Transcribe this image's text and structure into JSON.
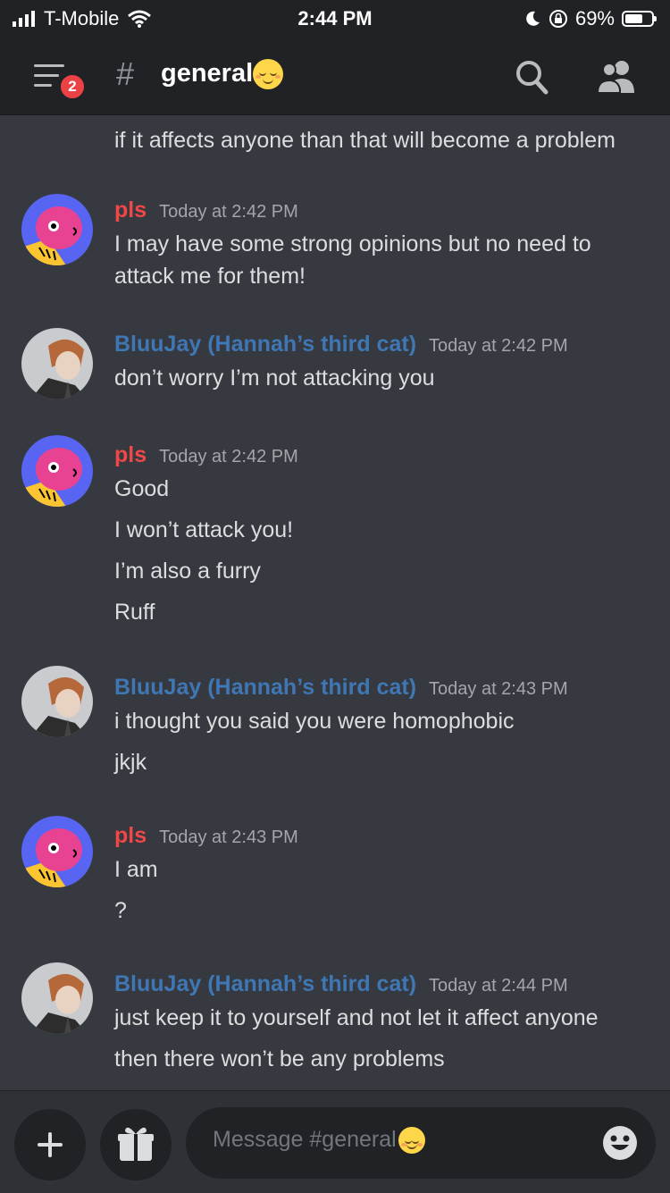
{
  "status_bar": {
    "carrier": "T-Mobile",
    "time": "2:44 PM",
    "battery_percent": "69%",
    "battery_level": 0.69
  },
  "header": {
    "unread_badge": "2",
    "hash": "#",
    "channel_name": "general"
  },
  "colors": {
    "background": "#36393f",
    "header": "#202225",
    "pls_name": "#f04747",
    "bluujay_name": "#3f77b4",
    "badge": "#ed4245"
  },
  "messages": {
    "continued": {
      "lines": [
        "if it affects anyone than that will become a problem"
      ]
    },
    "group1": {
      "author": "pls",
      "timestamp": "Today at 2:42 PM",
      "lines": [
        "I may have some strong opinions but no need to",
        "attack me for them!"
      ]
    },
    "group2": {
      "author": "BluuJay (Hannah’s third cat)",
      "timestamp": "Today at 2:42 PM",
      "lines": [
        "don’t worry I’m not attacking you"
      ]
    },
    "group3": {
      "author": "pls",
      "timestamp": "Today at 2:42 PM",
      "lines": [
        "Good",
        "I won’t attack you!",
        "I’m also a furry",
        "Ruff"
      ]
    },
    "group4": {
      "author": "BluuJay (Hannah’s third cat)",
      "timestamp": "Today at 2:43 PM",
      "lines": [
        "i thought you said you were homophobic",
        "jkjk"
      ]
    },
    "group5": {
      "author": "pls",
      "timestamp": "Today at 2:43 PM",
      "lines": [
        "I am",
        "?"
      ]
    },
    "group6": {
      "author": "BluuJay (Hannah’s third cat)",
      "timestamp": "Today at 2:44 PM",
      "lines": [
        "just keep it to yourself and not let it affect anyone",
        "then there won’t be any problems"
      ]
    }
  },
  "composer": {
    "placeholder": "Message #general"
  },
  "icons": [
    "signal-icon",
    "wifi-icon",
    "moon-icon",
    "rotation-lock-icon",
    "battery-icon",
    "menu-icon",
    "search-icon",
    "members-icon",
    "plus-icon",
    "gift-icon",
    "emoji-icon"
  ]
}
